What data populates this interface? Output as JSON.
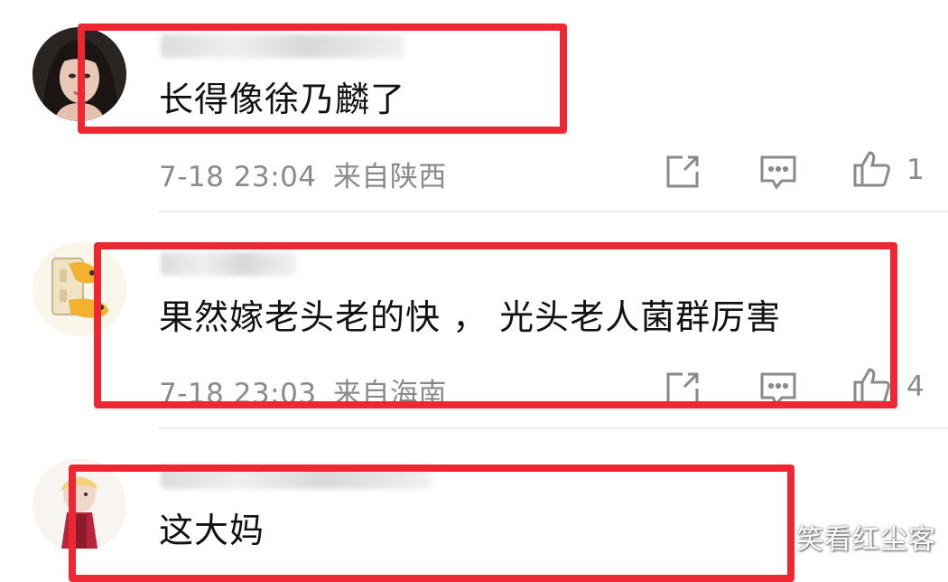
{
  "comments": [
    {
      "text": "长得像徐乃麟了",
      "time": "7-18 23:04",
      "location": "来自陕西",
      "likes": "1"
    },
    {
      "text": "果然嫁老头老的快 ， 光头老人菌群厉害",
      "time": "7-18 23:03",
      "location": "来自海南",
      "likes": "4"
    },
    {
      "text": "这大妈"
    }
  ],
  "watermark": "笑看红尘客",
  "icons": {
    "share": "share-icon",
    "reply": "comment-icon",
    "like": "thumbs-up-icon"
  },
  "colors": {
    "highlight": "#ee2832",
    "meta_text": "#8a8a8a"
  }
}
